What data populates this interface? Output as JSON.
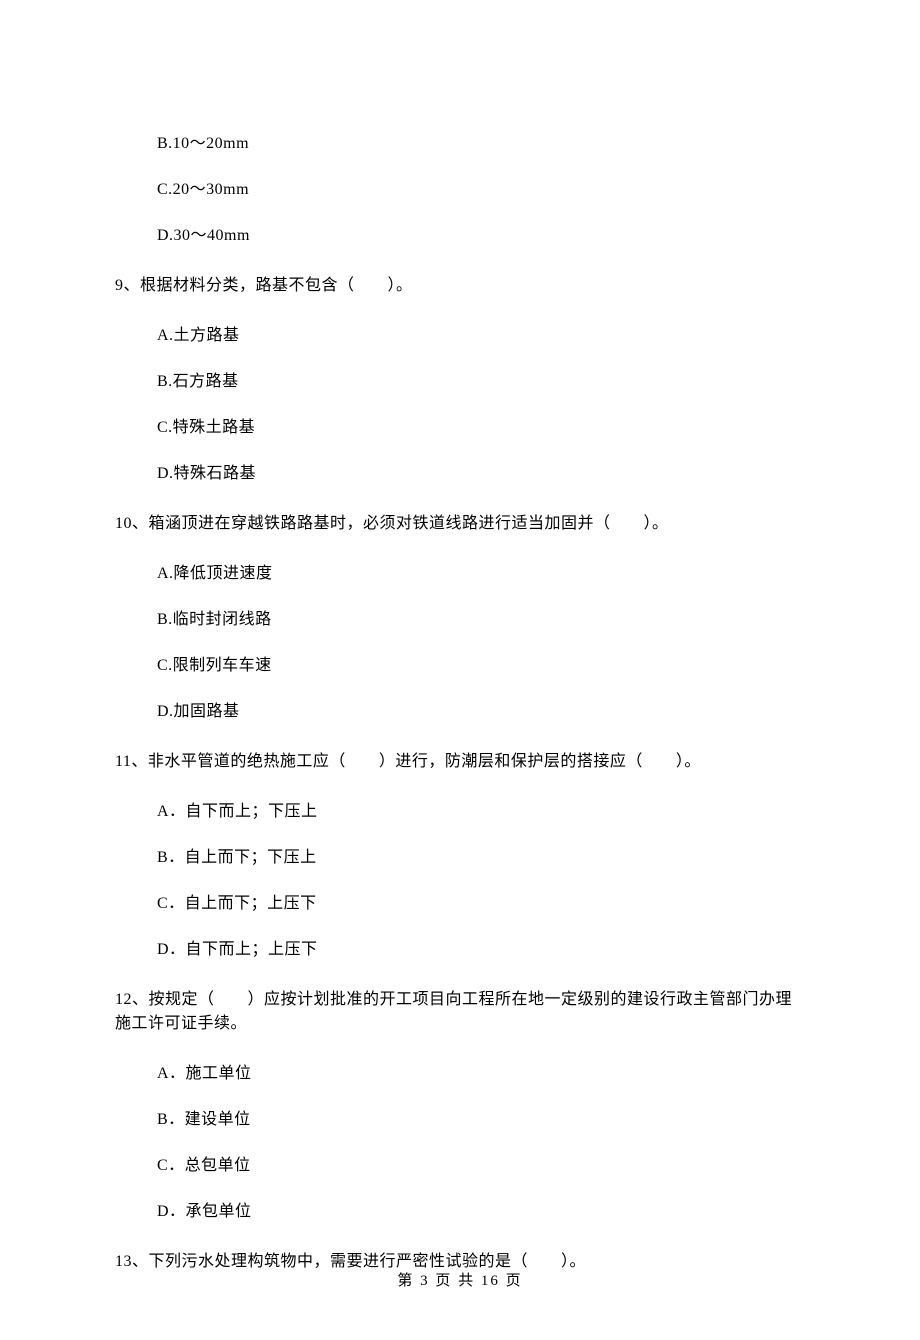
{
  "leading_options": {
    "b": "B.10～20mm",
    "c": "C.20～30mm",
    "d": "D.30～40mm"
  },
  "questions": [
    {
      "num": "9、根据材料分类，路基不包含（　　）。",
      "opts": {
        "a": "A.土方路基",
        "b": "B.石方路基",
        "c": "C.特殊土路基",
        "d": "D.特殊石路基"
      }
    },
    {
      "num": "10、箱涵顶进在穿越铁路路基时，必须对铁道线路进行适当加固并（　　）。",
      "opts": {
        "a": "A.降低顶进速度",
        "b": "B.临时封闭线路",
        "c": "C.限制列车车速",
        "d": "D.加固路基"
      }
    },
    {
      "num": "11、非水平管道的绝热施工应（　　）进行，防潮层和保护层的搭接应（　　）。",
      "opts": {
        "a": "A．自下而上；下压上",
        "b": "B．自上而下；下压上",
        "c": "C．自上而下；上压下",
        "d": "D．自下而上；上压下"
      }
    },
    {
      "num": "12、按规定（　　）应按计划批准的开工项目向工程所在地一定级别的建设行政主管部门办理施工许可证手续。",
      "opts": {
        "a": "A．施工单位",
        "b": "B．建设单位",
        "c": "C．总包单位",
        "d": "D．承包单位"
      }
    },
    {
      "num": "13、下列污水处理构筑物中，需要进行严密性试验的是（　　）。",
      "opts": null
    }
  ],
  "footer": "第 3 页 共 16 页"
}
